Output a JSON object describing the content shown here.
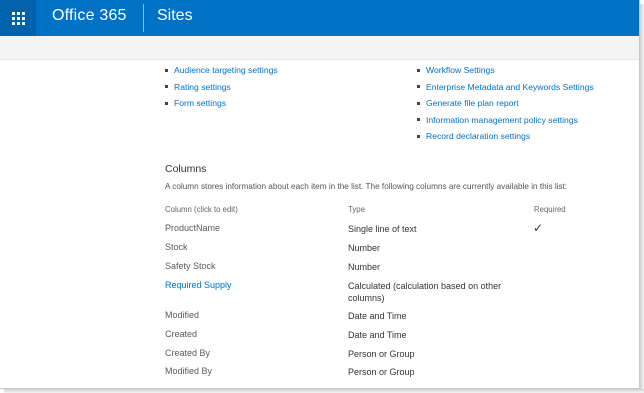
{
  "suitebar": {
    "brand": "Office 365",
    "app": "Sites"
  },
  "settings": {
    "left_links": [
      "Audience targeting settings",
      "Rating settings",
      "Form settings"
    ],
    "right_links": [
      "Workflow Settings",
      "Enterprise Metadata and Keywords Settings",
      "Generate file plan report",
      "Information management policy settings",
      "Record declaration settings"
    ]
  },
  "columns": {
    "title": "Columns",
    "description": "A column stores information about each item in the list. The following columns are currently available in this list:",
    "headers": {
      "column": "Column (click to edit)",
      "type": "Type",
      "required": "Required"
    },
    "rows": [
      {
        "name": "ProductName",
        "type": "Single line of text",
        "required": "✓",
        "is_link": false
      },
      {
        "name": "Stock",
        "type": "Number",
        "required": "",
        "is_link": false
      },
      {
        "name": "Safety Stock",
        "type": "Number",
        "required": "",
        "is_link": false
      },
      {
        "name": "Required Supply",
        "type": "Calculated (calculation based on other columns)",
        "required": "",
        "is_link": true
      },
      {
        "name": "Modified",
        "type": "Date and Time",
        "required": "",
        "is_link": false
      },
      {
        "name": "Created",
        "type": "Date and Time",
        "required": "",
        "is_link": false
      },
      {
        "name": "Created By",
        "type": "Person or Group",
        "required": "",
        "is_link": false
      },
      {
        "name": "Modified By",
        "type": "Person or Group",
        "required": "",
        "is_link": false
      }
    ]
  },
  "colors": {
    "suitebar": "#0072c6",
    "link": "#0072c6"
  }
}
